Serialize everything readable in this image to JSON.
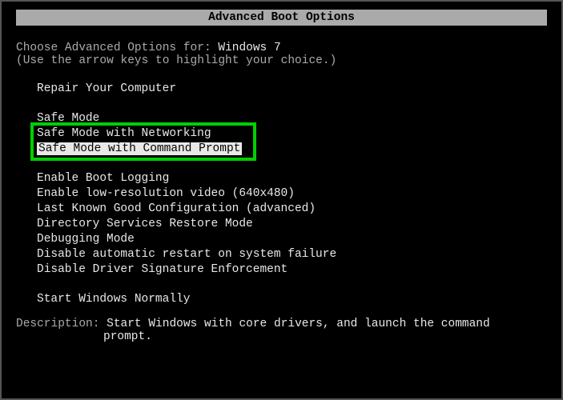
{
  "title": "Advanced Boot Options",
  "prompt_prefix": "Choose Advanced Options for: ",
  "os_name": "Windows 7",
  "hint": "(Use the arrow keys to highlight your choice.)",
  "options": {
    "repair": "Repair Your Computer",
    "safe_mode": "Safe Mode",
    "safe_mode_net": "Safe Mode with Networking",
    "safe_mode_cmd": "Safe Mode with Command Prompt",
    "boot_logging": "Enable Boot Logging",
    "low_res": "Enable low-resolution video (640x480)",
    "last_known": "Last Known Good Configuration (advanced)",
    "ds_restore": "Directory Services Restore Mode",
    "debugging": "Debugging Mode",
    "no_auto_restart": "Disable automatic restart on system failure",
    "no_driver_sig": "Disable Driver Signature Enforcement",
    "normal": "Start Windows Normally"
  },
  "desc_label": "Description: ",
  "desc_line1": "Start Windows with core drivers, and launch the command",
  "desc_line2": "prompt."
}
